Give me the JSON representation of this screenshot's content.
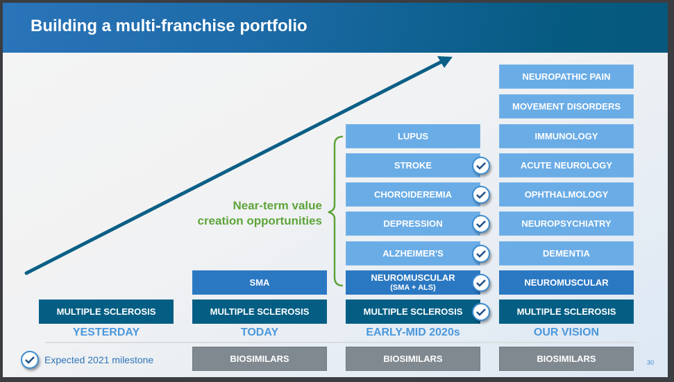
{
  "header": {
    "title": "Building a multi-franchise portfolio"
  },
  "near_term": {
    "line1": "Near-term value",
    "line2": "creation opportunities"
  },
  "columns": {
    "yesterday": {
      "label": "YESTERDAY",
      "items": [
        {
          "label": "MULTIPLE SCLEROSIS",
          "milestone": false
        }
      ]
    },
    "today": {
      "label": "TODAY",
      "items": [
        {
          "label": "SMA",
          "milestone": false
        },
        {
          "label": "MULTIPLE SCLEROSIS",
          "milestone": false
        }
      ],
      "footer": "BIOSIMILARS"
    },
    "early_mid": {
      "label": "EARLY-MID 2020s",
      "items": [
        {
          "label": "LUPUS",
          "milestone": false
        },
        {
          "label": "STROKE",
          "milestone": true
        },
        {
          "label": "CHOROIDEREMIA",
          "milestone": true
        },
        {
          "label": "DEPRESSION",
          "milestone": true
        },
        {
          "label": "ALZHEIMER'S",
          "milestone": true
        },
        {
          "label": "NEUROMUSCULAR",
          "sublabel": "(SMA + ALS)",
          "milestone": true
        },
        {
          "label": "MULTIPLE SCLEROSIS",
          "milestone": true
        }
      ],
      "footer": "BIOSIMILARS"
    },
    "vision": {
      "label": "OUR VISION",
      "items": [
        {
          "label": "NEUROPATHIC PAIN"
        },
        {
          "label": "MOVEMENT DISORDERS"
        },
        {
          "label": "IMMUNOLOGY"
        },
        {
          "label": "ACUTE NEUROLOGY"
        },
        {
          "label": "OPHTHALMOLOGY"
        },
        {
          "label": "NEUROPSYCHIATRY"
        },
        {
          "label": "DEMENTIA"
        },
        {
          "label": "NEUROMUSCULAR"
        },
        {
          "label": "MULTIPLE SCLEROSIS"
        }
      ],
      "footer": "BIOSIMILARS"
    }
  },
  "legend": {
    "icon": "check-circle-icon",
    "label": "Expected 2021 milestone"
  },
  "page_number": "30",
  "colors": {
    "dark": "#045e84",
    "mid": "#2b78c2",
    "light": "#6aace6",
    "grey": "#808990",
    "green": "#5ea43a",
    "era": "#4a97dc"
  }
}
